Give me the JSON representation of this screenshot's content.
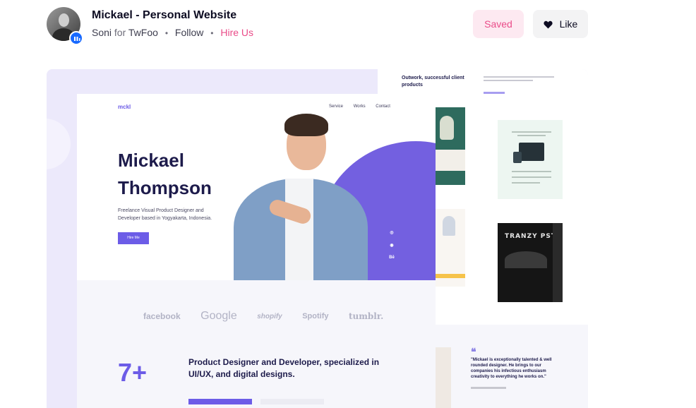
{
  "header": {
    "title": "Mickael - Personal Website",
    "author": "Soni",
    "for_label": "for",
    "team": "TwFoo",
    "follow_label": "Follow",
    "hire_label": "Hire Us",
    "saved_label": "Saved",
    "like_label": "Like"
  },
  "shot": {
    "logo": "mckl",
    "nav": [
      "Service",
      "Works",
      "Contact"
    ],
    "hero_name": "Mickael Thompson",
    "hero_name_lines": [
      "Mickael",
      "Thompson"
    ],
    "hero_desc": "Freelance  Visual Product Designer and Developer based in Yogyakarta, Indonesia.",
    "hero_button": "Hire Me",
    "social_icons": [
      "instagram-icon",
      "dribbble-icon",
      "behance-icon"
    ],
    "brands": [
      "facebook",
      "Google",
      "shopify",
      "Spotify",
      "tumblr."
    ],
    "stat_number": "7+",
    "stat_text": "Product Designer and Developer, specialized in UI/UX, and digital designs.",
    "works_title": "Outwork, successful client products",
    "work_tile_text": "TRANZY PST",
    "testimonial": "\"Mickael is exceptionally talented & well rounded designer. He brings to our companies his infectious enthusiasm creativity to everything he works on.\""
  },
  "colors": {
    "accent_pink": "#ea4c89",
    "brand_purple": "#6c5ce7",
    "card_bg": "#ece9fb"
  }
}
